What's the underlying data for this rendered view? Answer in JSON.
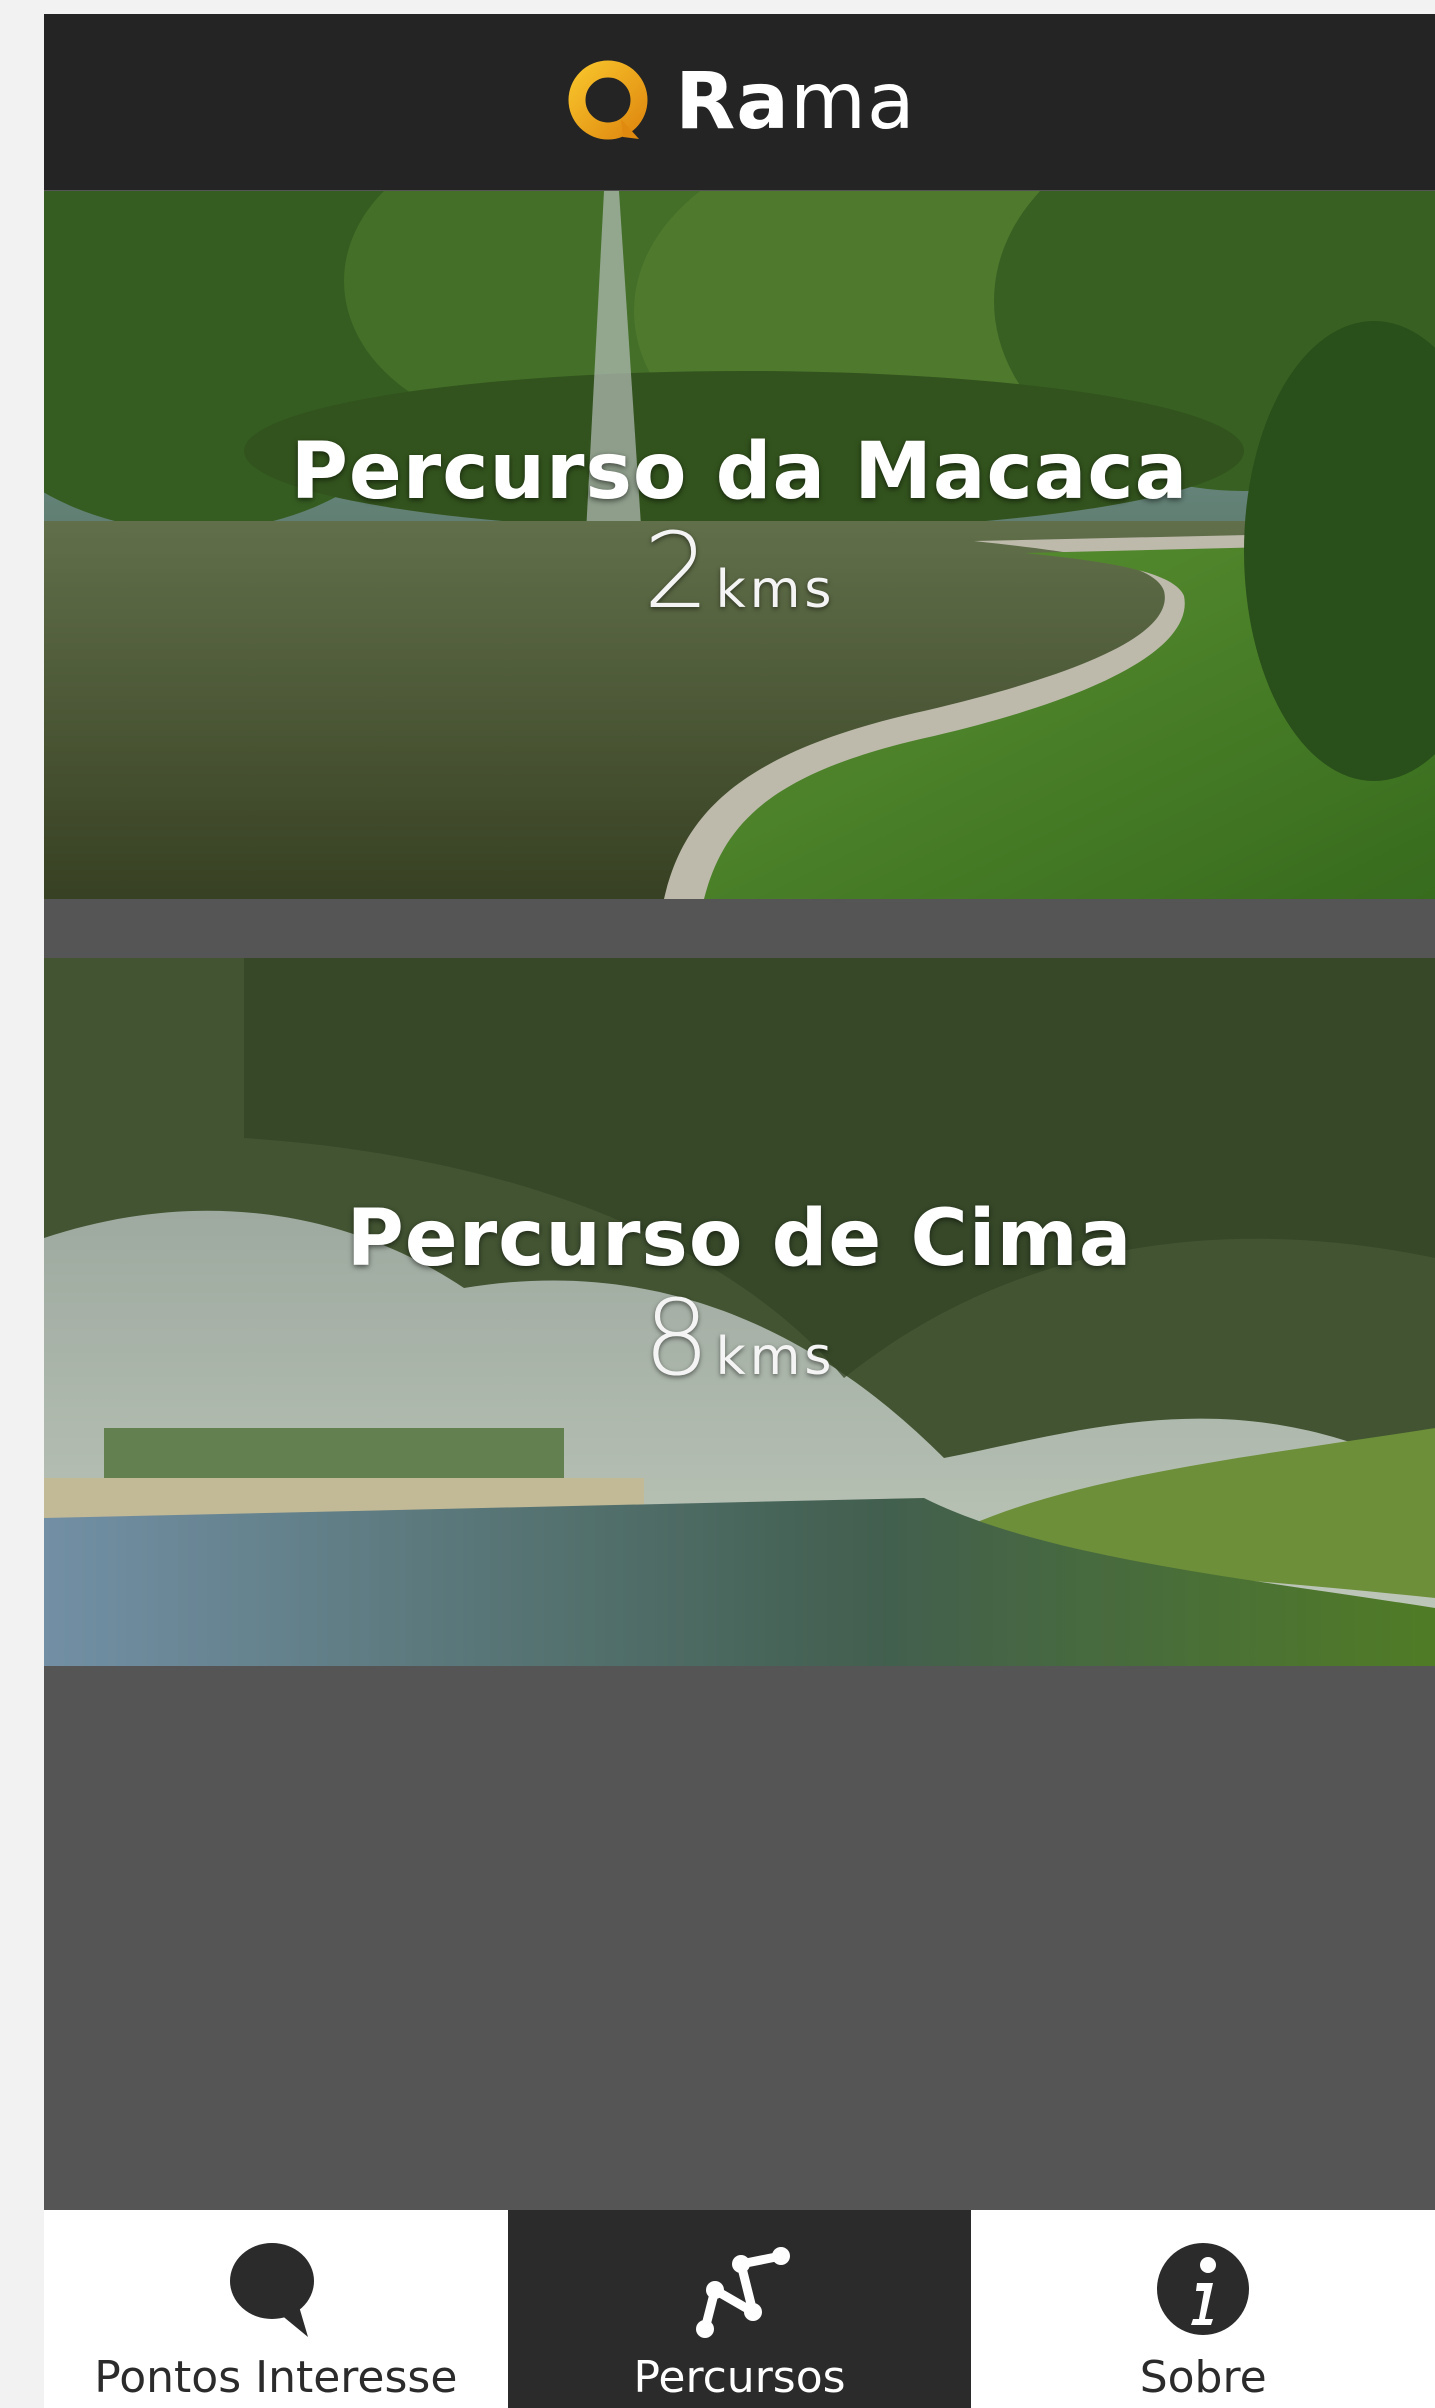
{
  "app": {
    "name_bold": "Ra",
    "name_light": "ma",
    "icon": "rama-logo-ring",
    "accent_color": "#f0a818"
  },
  "routes": [
    {
      "title": "Percurso da Macaca",
      "distance": "2",
      "unit": "kms"
    },
    {
      "title": "Percurso de Cima",
      "distance": "8",
      "unit": "kms"
    }
  ],
  "tabs": [
    {
      "label": "Pontos Interesse",
      "icon": "speech-bubble-icon",
      "active": false
    },
    {
      "label": "Percursos",
      "icon": "route-path-icon",
      "active": true
    },
    {
      "label": "Sobre",
      "icon": "info-icon",
      "active": false
    }
  ]
}
